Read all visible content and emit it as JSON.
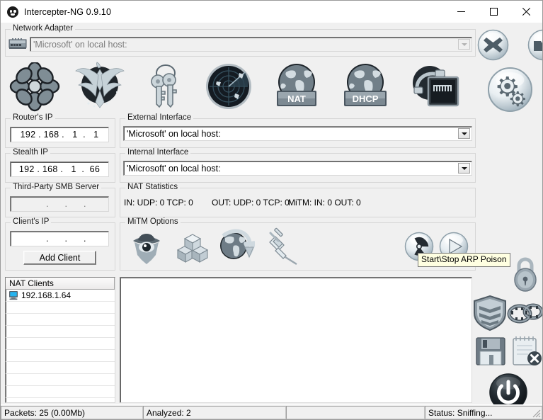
{
  "window": {
    "title": "Intercepter-NG 0.9.10",
    "app_icon": "skull-icon",
    "minimize_label": "Minimize",
    "maximize_label": "Maximize",
    "close_label": "Close"
  },
  "network_adapter": {
    "legend": "Network Adapter",
    "adapter_icon": "network-card-icon",
    "value": "'Microsoft' on local host:",
    "enabled": false
  },
  "toolbar": {
    "items": [
      {
        "name": "messengers-mode",
        "icon": "flower-icon",
        "label": ""
      },
      {
        "name": "resurrection-mode",
        "icon": "phoenix-icon",
        "label": ""
      },
      {
        "name": "passwords-mode",
        "icon": "keys-icon",
        "label": ""
      },
      {
        "name": "scan-mode",
        "icon": "radar-icon",
        "label": ""
      },
      {
        "name": "nat-mode",
        "icon": "globe-icon",
        "label": "NAT"
      },
      {
        "name": "dhcp-mode",
        "icon": "globe-icon",
        "label": "DHCP"
      },
      {
        "name": "raw-mode",
        "icon": "raw-capture-icon",
        "label": ""
      }
    ]
  },
  "right_buttons": {
    "clear": {
      "name": "clear-button",
      "icon": "x-icon"
    },
    "open": {
      "name": "open-file-button",
      "icon": "folder-icon"
    },
    "settings": {
      "name": "settings-button",
      "icon": "gears-icon"
    },
    "lock": {
      "name": "lock-button",
      "icon": "padlock-icon"
    },
    "shield": {
      "name": "shield-button",
      "icon": "shield-icon"
    },
    "chains": {
      "name": "chains-button",
      "icon": "chains-icon"
    },
    "save": {
      "name": "save-button",
      "icon": "floppy-icon"
    },
    "clear_log": {
      "name": "clear-log-button",
      "icon": "notepad-x-icon"
    },
    "power": {
      "name": "power-button",
      "icon": "power-icon"
    }
  },
  "routers_ip": {
    "legend": "Router's IP",
    "value": "192 . 168 .   1  .   1",
    "enabled": true
  },
  "stealth_ip": {
    "legend": "Stealth IP",
    "value": "192 . 168 .   1  .  66",
    "enabled": true
  },
  "smb_server": {
    "legend": "Third-Party SMB Server",
    "value": "     .      .      .",
    "enabled": false
  },
  "clients_ip": {
    "legend": "Client's IP",
    "value": "     .      .      .",
    "enabled": true,
    "add_button_label": "Add Client"
  },
  "external_interface": {
    "legend": "External Interface",
    "value": "'Microsoft' on local host:",
    "enabled": true
  },
  "internal_interface": {
    "legend": "Internal Interface",
    "value": "'Microsoft' on local host:",
    "enabled": true
  },
  "nat_statistics": {
    "legend": "NAT Statistics",
    "in_text": "IN: UDP: 0 TCP: 0",
    "out_text": "OUT: UDP: 0 TCP: 0",
    "mitm_text": "MiTM: IN: 0 OUT: 0"
  },
  "mitm_options": {
    "legend": "MiTM Options",
    "items": [
      {
        "name": "spoofing-toggle",
        "icon": "spy-icon"
      },
      {
        "name": "ssl-mitm-toggle",
        "icon": "cubes-icon"
      },
      {
        "name": "ssl-strip-toggle",
        "icon": "globe-arrow-icon"
      },
      {
        "name": "inject-toggle",
        "icon": "syringe-icon"
      }
    ],
    "arp_poison": {
      "name": "arp-poison-button",
      "icon": "radiation-icon"
    },
    "start": {
      "name": "start-button",
      "icon": "play-icon"
    }
  },
  "tooltip": {
    "text": "Start\\Stop ARP Poison"
  },
  "nat_clients": {
    "header": "NAT Clients",
    "rows": [
      {
        "icon": "computer-icon",
        "label": "192.168.1.64"
      }
    ]
  },
  "log_panel": {
    "content": ""
  },
  "status_bar": {
    "packets": "Packets: 25 (0.00Mb)",
    "analyzed": "Analyzed: 2",
    "middle": "",
    "status": "Status: Sniffing..."
  },
  "colors": {
    "face": "#f0f0f0",
    "tooltip_bg": "#ffffe1",
    "field_bg": "#ffffff",
    "border": "#d6d6d6"
  }
}
